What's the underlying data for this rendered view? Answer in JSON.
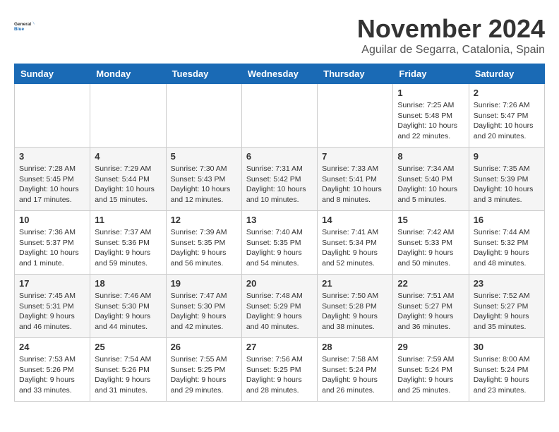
{
  "logo": {
    "general": "General",
    "blue": "Blue"
  },
  "title": "November 2024",
  "location": "Aguilar de Segarra, Catalonia, Spain",
  "days_of_week": [
    "Sunday",
    "Monday",
    "Tuesday",
    "Wednesday",
    "Thursday",
    "Friday",
    "Saturday"
  ],
  "weeks": [
    [
      {
        "day": "",
        "info": ""
      },
      {
        "day": "",
        "info": ""
      },
      {
        "day": "",
        "info": ""
      },
      {
        "day": "",
        "info": ""
      },
      {
        "day": "",
        "info": ""
      },
      {
        "day": "1",
        "info": "Sunrise: 7:25 AM\nSunset: 5:48 PM\nDaylight: 10 hours and 22 minutes."
      },
      {
        "day": "2",
        "info": "Sunrise: 7:26 AM\nSunset: 5:47 PM\nDaylight: 10 hours and 20 minutes."
      }
    ],
    [
      {
        "day": "3",
        "info": "Sunrise: 7:28 AM\nSunset: 5:45 PM\nDaylight: 10 hours and 17 minutes."
      },
      {
        "day": "4",
        "info": "Sunrise: 7:29 AM\nSunset: 5:44 PM\nDaylight: 10 hours and 15 minutes."
      },
      {
        "day": "5",
        "info": "Sunrise: 7:30 AM\nSunset: 5:43 PM\nDaylight: 10 hours and 12 minutes."
      },
      {
        "day": "6",
        "info": "Sunrise: 7:31 AM\nSunset: 5:42 PM\nDaylight: 10 hours and 10 minutes."
      },
      {
        "day": "7",
        "info": "Sunrise: 7:33 AM\nSunset: 5:41 PM\nDaylight: 10 hours and 8 minutes."
      },
      {
        "day": "8",
        "info": "Sunrise: 7:34 AM\nSunset: 5:40 PM\nDaylight: 10 hours and 5 minutes."
      },
      {
        "day": "9",
        "info": "Sunrise: 7:35 AM\nSunset: 5:39 PM\nDaylight: 10 hours and 3 minutes."
      }
    ],
    [
      {
        "day": "10",
        "info": "Sunrise: 7:36 AM\nSunset: 5:37 PM\nDaylight: 10 hours and 1 minute."
      },
      {
        "day": "11",
        "info": "Sunrise: 7:37 AM\nSunset: 5:36 PM\nDaylight: 9 hours and 59 minutes."
      },
      {
        "day": "12",
        "info": "Sunrise: 7:39 AM\nSunset: 5:35 PM\nDaylight: 9 hours and 56 minutes."
      },
      {
        "day": "13",
        "info": "Sunrise: 7:40 AM\nSunset: 5:35 PM\nDaylight: 9 hours and 54 minutes."
      },
      {
        "day": "14",
        "info": "Sunrise: 7:41 AM\nSunset: 5:34 PM\nDaylight: 9 hours and 52 minutes."
      },
      {
        "day": "15",
        "info": "Sunrise: 7:42 AM\nSunset: 5:33 PM\nDaylight: 9 hours and 50 minutes."
      },
      {
        "day": "16",
        "info": "Sunrise: 7:44 AM\nSunset: 5:32 PM\nDaylight: 9 hours and 48 minutes."
      }
    ],
    [
      {
        "day": "17",
        "info": "Sunrise: 7:45 AM\nSunset: 5:31 PM\nDaylight: 9 hours and 46 minutes."
      },
      {
        "day": "18",
        "info": "Sunrise: 7:46 AM\nSunset: 5:30 PM\nDaylight: 9 hours and 44 minutes."
      },
      {
        "day": "19",
        "info": "Sunrise: 7:47 AM\nSunset: 5:30 PM\nDaylight: 9 hours and 42 minutes."
      },
      {
        "day": "20",
        "info": "Sunrise: 7:48 AM\nSunset: 5:29 PM\nDaylight: 9 hours and 40 minutes."
      },
      {
        "day": "21",
        "info": "Sunrise: 7:50 AM\nSunset: 5:28 PM\nDaylight: 9 hours and 38 minutes."
      },
      {
        "day": "22",
        "info": "Sunrise: 7:51 AM\nSunset: 5:27 PM\nDaylight: 9 hours and 36 minutes."
      },
      {
        "day": "23",
        "info": "Sunrise: 7:52 AM\nSunset: 5:27 PM\nDaylight: 9 hours and 35 minutes."
      }
    ],
    [
      {
        "day": "24",
        "info": "Sunrise: 7:53 AM\nSunset: 5:26 PM\nDaylight: 9 hours and 33 minutes."
      },
      {
        "day": "25",
        "info": "Sunrise: 7:54 AM\nSunset: 5:26 PM\nDaylight: 9 hours and 31 minutes."
      },
      {
        "day": "26",
        "info": "Sunrise: 7:55 AM\nSunset: 5:25 PM\nDaylight: 9 hours and 29 minutes."
      },
      {
        "day": "27",
        "info": "Sunrise: 7:56 AM\nSunset: 5:25 PM\nDaylight: 9 hours and 28 minutes."
      },
      {
        "day": "28",
        "info": "Sunrise: 7:58 AM\nSunset: 5:24 PM\nDaylight: 9 hours and 26 minutes."
      },
      {
        "day": "29",
        "info": "Sunrise: 7:59 AM\nSunset: 5:24 PM\nDaylight: 9 hours and 25 minutes."
      },
      {
        "day": "30",
        "info": "Sunrise: 8:00 AM\nSunset: 5:24 PM\nDaylight: 9 hours and 23 minutes."
      }
    ]
  ]
}
